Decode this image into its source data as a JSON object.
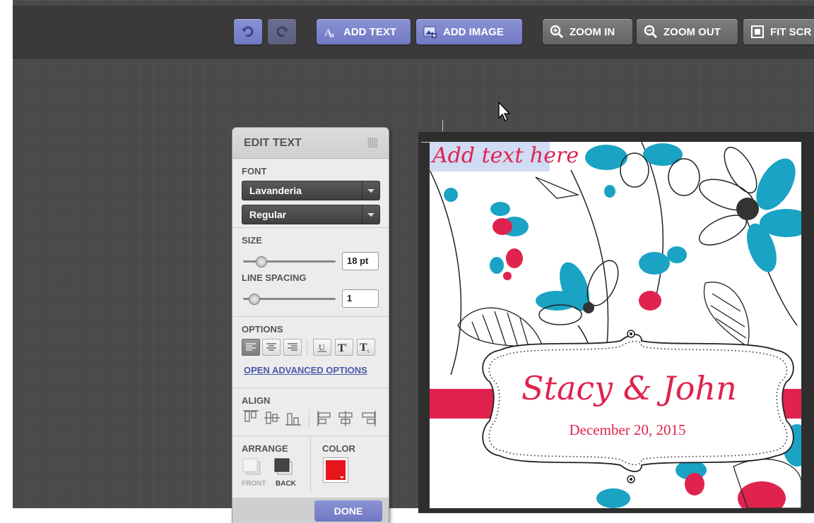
{
  "toolbar": {
    "undo_icon": "undo-icon",
    "redo_icon": "redo-icon",
    "add_text": "ADD TEXT",
    "add_image": "ADD IMAGE",
    "zoom_in": "ZOOM IN",
    "zoom_out": "ZOOM OUT",
    "fit_screen": "FIT SCR"
  },
  "panel": {
    "title": "EDIT TEXT",
    "font_label": "FONT",
    "font_family": "Lavanderia",
    "font_style": "Regular",
    "size_label": "SIZE",
    "size_value": "18 pt",
    "line_spacing_label": "LINE SPACING",
    "line_spacing_value": "1",
    "options_label": "OPTIONS",
    "advanced_link": "OPEN ADVANCED OPTIONS",
    "align_label": "ALIGN",
    "arrange_label": "ARRANGE",
    "front_label": "FRONT",
    "back_label": "BACK",
    "color_label": "COLOR",
    "color_value": "#e8141e",
    "done_label": "DONE"
  },
  "card": {
    "placeholder_text": "Add text here",
    "names": "Stacy & John",
    "date": "December 20, 2015",
    "accent": "#e0234e",
    "teal": "#1aa3c4"
  }
}
